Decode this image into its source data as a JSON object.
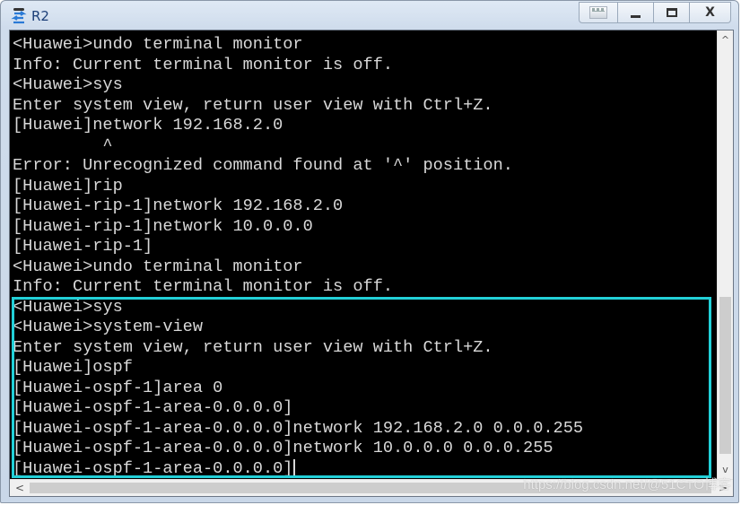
{
  "window": {
    "title": "R2",
    "icon": "router-console-icon",
    "controls": {
      "snap": "snap-icon",
      "minimize": "minimize-icon",
      "maximize": "maximize-icon",
      "close": "X"
    }
  },
  "terminal": {
    "lines": [
      "<Huawei>undo terminal monitor",
      "Info: Current terminal monitor is off.",
      "<Huawei>sys",
      "Enter system view, return user view with Ctrl+Z.",
      "[Huawei]network 192.168.2.0",
      "         ^",
      "Error: Unrecognized command found at '^' position.",
      "[Huawei]rip",
      "[Huawei-rip-1]network 192.168.2.0",
      "[Huawei-rip-1]network 10.0.0.0",
      "[Huawei-rip-1]",
      "<Huawei>undo terminal monitor",
      "Info: Current terminal monitor is off.",
      "<Huawei>sys",
      "<Huawei>system-view",
      "Enter system view, return user view with Ctrl+Z.",
      "[Huawei]ospf",
      "[Huawei-ospf-1]area 0",
      "[Huawei-ospf-1-area-0.0.0.0]",
      "[Huawei-ospf-1-area-0.0.0.0]network 192.168.2.0 0.0.0.255",
      "[Huawei-ospf-1-area-0.0.0.0]network 10.0.0.0 0.0.0.255",
      "[Huawei-ospf-1-area-0.0.0.0]"
    ],
    "highlight_color": "#22d0d8",
    "text_color": "#d8d8d8",
    "background": "#000000"
  },
  "scrollbars": {
    "up": "^",
    "down": "v",
    "left": "<",
    "right": ">"
  },
  "watermark": "https://blog.csdn.net/@51CTO博客"
}
